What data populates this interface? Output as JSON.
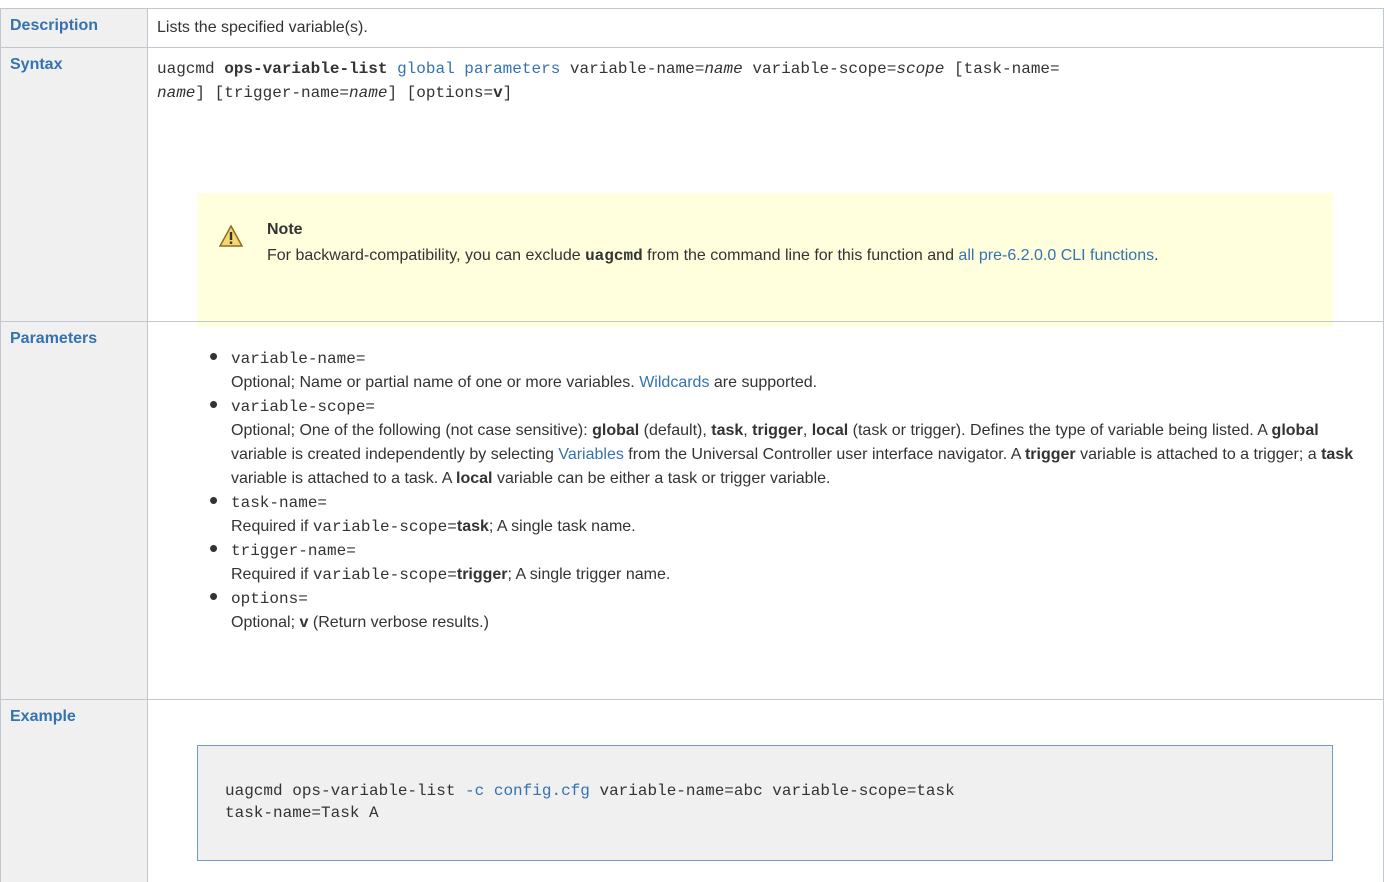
{
  "rows": {
    "description": {
      "label": "Description",
      "text": "Lists the specified variable(s)."
    },
    "syntax": {
      "label": "Syntax",
      "cmd": "uagcmd",
      "fn": "ops-variable-list",
      "global_link": "global parameters",
      "p1": "variable-name=",
      "p1v": "name",
      "p2": "variable-scope=",
      "p2v": "scope",
      "p3": "[task-name=",
      "p3v": "name",
      "p4": "] [trigger-name=",
      "p4v": "name",
      "p5": "] [options=",
      "p5v": "v",
      "p6": "]",
      "note": {
        "icon": "warning-icon",
        "title": "Note",
        "text1": "For backward-compatibility, you can exclude",
        "bold": "uagcmd",
        "text2": "from the command line for this function and",
        "link": "all pre-6.2.0.0 CLI functions",
        "text3": "."
      }
    },
    "parameters": {
      "label": "Parameters",
      "items": [
        {
          "name": "variable-name=",
          "d1": "Optional; Name or partial name of one or more variables.",
          "link": "Wildcards",
          "d2": "are supported."
        },
        {
          "name": "variable-scope=",
          "d_a": "Optional; One of the following (not case sensitive):",
          "global": "global",
          "default": "(default),",
          "task": "task",
          "trigger": "trigger",
          "local": "local",
          "d_b": "(task or trigger). Defines the type of variable being listed. A",
          "global2": "global",
          "d_c": "variable is created independently by selecting",
          "link": "Variables",
          "d_d": "from the Universal Controller user interface navigator. A",
          "trigger2": "trigger",
          "d_e": "variable is attached to a trigger; a",
          "task2": "task",
          "d_f": "variable is attached to a task. A",
          "local2": "local",
          "d_g": "variable can be either a task or trigger variable."
        },
        {
          "name": "task-name=",
          "req": "Required if",
          "code": "variable-scope=",
          "val": "task",
          "rest": "; A single task name."
        },
        {
          "name": "trigger-name=",
          "req": "Required if",
          "code": "variable-scope=",
          "val": "trigger",
          "rest": "; A single trigger name."
        },
        {
          "name": "options=",
          "opt": "Optional;",
          "val": "v",
          "rest": "(Return verbose results.)"
        }
      ]
    },
    "example": {
      "label": "Example",
      "c1": "uagcmd ops-variable-list ",
      "c2": "-c config.cfg",
      "c3": " variable-name=abc variable-scope=task",
      "line2": "task-name=Task A"
    }
  }
}
